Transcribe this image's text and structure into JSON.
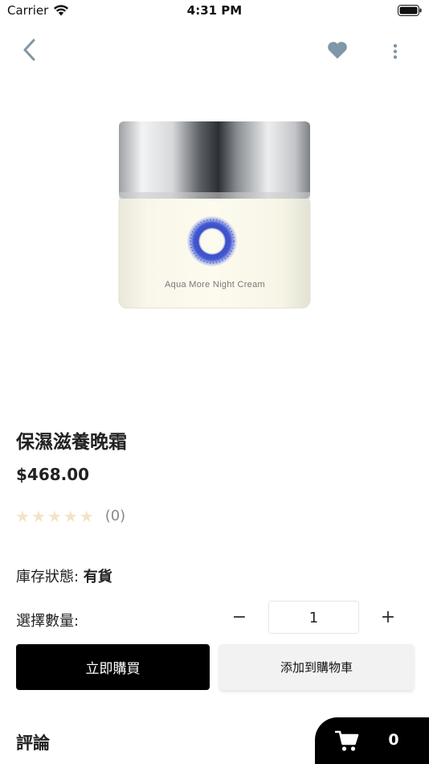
{
  "status_bar": {
    "carrier": "Carrier",
    "time": "4:31 PM"
  },
  "nav": {
    "back_icon": "chevron-left-icon",
    "favorite_icon": "heart-icon",
    "more_icon": "more-vertical-icon",
    "icon_color": "#7f97a6"
  },
  "product": {
    "image_label": "Aqua More Night Cream",
    "title": "保濕滋養晚霜",
    "price": "$468.00",
    "rating": 0,
    "rating_max": 5,
    "review_count": "(0)",
    "stock_label": "庫存狀態: ",
    "stock_value": "有貨"
  },
  "quantity": {
    "label": "選擇數量:",
    "minus": "−",
    "value": "1",
    "plus": "+"
  },
  "actions": {
    "buy_now": "立即購買",
    "add_to_cart": "添加到購物車"
  },
  "reviews": {
    "heading": "評論"
  },
  "cart": {
    "icon": "shopping-cart-icon",
    "count": "0"
  },
  "colors": {
    "accent_dark": "#000000",
    "star_empty": "#f5e2c8",
    "secondary_button": "#f2f2f2"
  }
}
